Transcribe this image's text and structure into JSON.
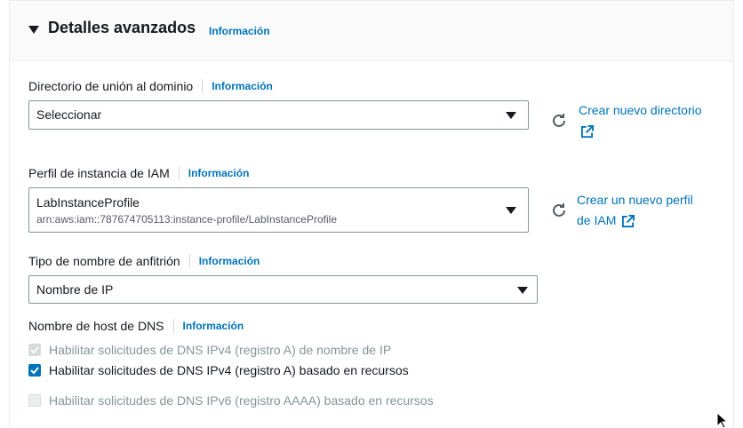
{
  "section": {
    "title": "Detalles avanzados",
    "info": "Información"
  },
  "domain_dir": {
    "label": "Directorio de unión al dominio",
    "info": "Información",
    "value": "Seleccionar",
    "link_line1": "Crear nuevo directorio"
  },
  "iam_profile": {
    "label": "Perfil de instancia de IAM",
    "info": "Información",
    "value": "LabInstanceProfile",
    "arn": "arn:aws:iam::787674705113:instance-profile/LabInstanceProfile",
    "link_line1": "Crear un nuevo perfil",
    "link_line2": "de IAM"
  },
  "hostname_type": {
    "label": "Tipo de nombre de anfitrión",
    "info": "Información",
    "value": "Nombre de IP"
  },
  "dns_hostname": {
    "label": "Nombre de host de DNS",
    "info": "Información",
    "options": [
      {
        "label": "Habilitar solicitudes de DNS IPv4 (registro A) de nombre de IP",
        "checked": true,
        "disabled": true
      },
      {
        "label": "Habilitar solicitudes de DNS IPv4 (registro A) basado en recursos",
        "checked": true,
        "disabled": false
      },
      {
        "label": "Habilitar solicitudes de DNS IPv6 (registro AAAA) basado en recursos",
        "checked": false,
        "disabled": true
      }
    ]
  },
  "colors": {
    "link": "#0073bb",
    "checkbox_on": "#0073bb",
    "disabled": "#879596"
  }
}
